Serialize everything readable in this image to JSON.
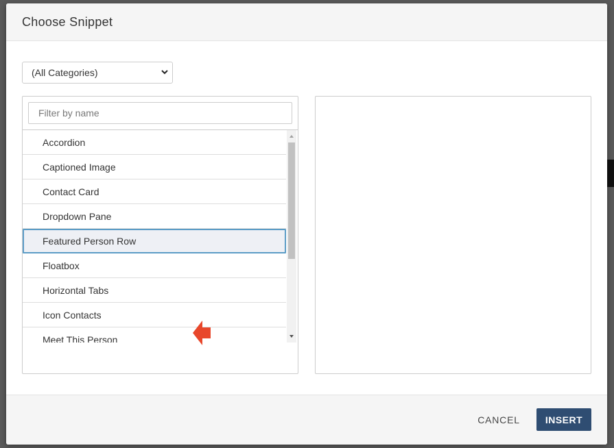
{
  "dialog": {
    "title": "Choose Snippet"
  },
  "category_select": {
    "selected": "(All Categories)"
  },
  "filter": {
    "placeholder": "Filter by name"
  },
  "snippets": [
    {
      "label": "Accordion"
    },
    {
      "label": "Captioned Image"
    },
    {
      "label": "Contact Card"
    },
    {
      "label": "Dropdown Pane"
    },
    {
      "label": "Featured Person Row",
      "selected": true
    },
    {
      "label": "Floatbox"
    },
    {
      "label": "Horizontal Tabs"
    },
    {
      "label": "Icon Contacts"
    },
    {
      "label": "Meet This Person"
    }
  ],
  "footer": {
    "cancel_label": "CANCEL",
    "insert_label": "INSERT"
  },
  "colors": {
    "accent": "#2f4d72",
    "selection_border": "#5b9cc6",
    "annotation_arrow": "#e8472b"
  },
  "icons": {
    "select": "chevron-down-icon",
    "annotation": "arrow-left-icon"
  }
}
